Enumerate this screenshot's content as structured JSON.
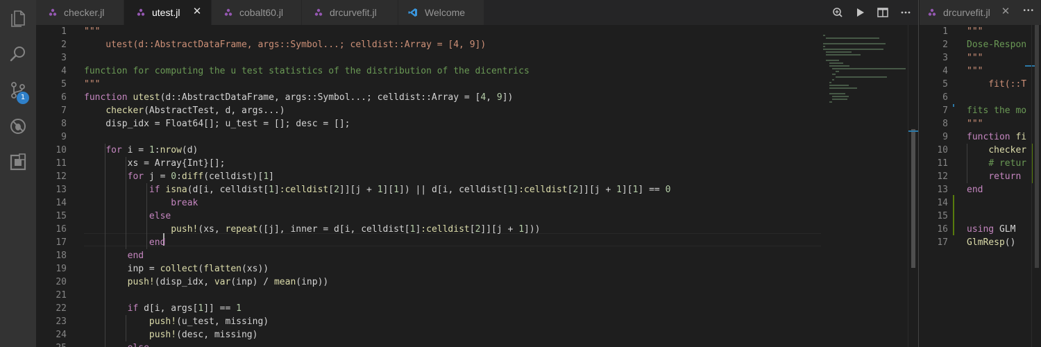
{
  "activity_bar": {
    "items": [
      "files-icon",
      "search-icon",
      "source-control-icon",
      "debug-icon",
      "extensions-icon"
    ],
    "source_control_badge": "1"
  },
  "tabs": [
    {
      "label": "checker.jl",
      "active": false,
      "icon": "julia-file-icon"
    },
    {
      "label": "utest.jl",
      "active": true,
      "icon": "julia-file-icon",
      "close": "✕"
    },
    {
      "label": "cobalt60.jl",
      "active": false,
      "icon": "julia-file-icon"
    },
    {
      "label": "drcurvefit.jl",
      "active": false,
      "icon": "julia-file-icon"
    },
    {
      "label": "Welcome",
      "active": false,
      "icon": "vscode-icon"
    }
  ],
  "tab_actions": [
    "open-changes-icon",
    "run-icon",
    "split-editor-icon",
    "more-actions-icon"
  ],
  "right_group": {
    "tab": {
      "label": "drcurvefit.jl",
      "close": "✕"
    },
    "more_actions": "•••"
  },
  "colors": {
    "accent": "#2f80c9",
    "string": "#ce9178",
    "keyword": "#c586c0",
    "function": "#dcdcaa",
    "number": "#b5cea8"
  },
  "main_editor": {
    "lines": [
      {
        "n": "1",
        "t": [
          [
            "t-str",
            "\"\"\""
          ]
        ]
      },
      {
        "n": "2",
        "t": [
          [
            "t-str",
            "    utest(d::AbstractDataFrame, args::Symbol...; celldist::Array = [4, 9])"
          ]
        ]
      },
      {
        "n": "3",
        "t": []
      },
      {
        "n": "4",
        "t": [
          [
            "t-doc",
            "function for computing the u test statistics of the distribution of the dicentrics"
          ]
        ]
      },
      {
        "n": "5",
        "t": [
          [
            "t-str",
            "\"\"\""
          ]
        ]
      },
      {
        "n": "6",
        "t": [
          [
            "t-kw",
            "function "
          ],
          [
            "t-fn",
            "utest"
          ],
          [
            "t-pl",
            "(d::AbstractDataFrame, args::Symbol...; celldist::Array = ["
          ],
          [
            "t-num",
            "4"
          ],
          [
            "t-pl",
            ", "
          ],
          [
            "t-num",
            "9"
          ],
          [
            "t-pl",
            "])"
          ]
        ]
      },
      {
        "n": "7",
        "t": [
          [
            "t-pl",
            "    "
          ],
          [
            "t-fn",
            "checker"
          ],
          [
            "t-pl",
            "(AbstractTest, d, args...)"
          ]
        ]
      },
      {
        "n": "8",
        "t": [
          [
            "t-pl",
            "    disp_idx = Float64[]; u_test = []; desc = [];"
          ]
        ]
      },
      {
        "n": "9",
        "t": []
      },
      {
        "n": "10",
        "t": [
          [
            "t-pl",
            "    "
          ],
          [
            "t-kw",
            "for"
          ],
          [
            "t-pl",
            " i = "
          ],
          [
            "t-num",
            "1"
          ],
          [
            "t-pl",
            ":"
          ],
          [
            "t-fn",
            "nrow"
          ],
          [
            "t-pl",
            "(d)"
          ]
        ]
      },
      {
        "n": "11",
        "t": [
          [
            "t-pl",
            "        xs = Array{Int}[];"
          ]
        ]
      },
      {
        "n": "12",
        "t": [
          [
            "t-pl",
            "        "
          ],
          [
            "t-kw",
            "for"
          ],
          [
            "t-pl",
            " j = "
          ],
          [
            "t-num",
            "0"
          ],
          [
            "t-pl",
            ":"
          ],
          [
            "t-fn",
            "diff"
          ],
          [
            "t-pl",
            "(celldist)["
          ],
          [
            "t-num",
            "1"
          ],
          [
            "t-pl",
            "]"
          ]
        ]
      },
      {
        "n": "13",
        "t": [
          [
            "t-pl",
            "            "
          ],
          [
            "t-kw",
            "if "
          ],
          [
            "t-fn",
            "isna"
          ],
          [
            "t-pl",
            "(d[i, celldist["
          ],
          [
            "t-num",
            "1"
          ],
          [
            "t-pl",
            "]"
          ],
          [
            "t-fn",
            ":celldist"
          ],
          [
            "t-pl",
            "["
          ],
          [
            "t-num",
            "2"
          ],
          [
            "t-pl",
            "]][j + "
          ],
          [
            "t-num",
            "1"
          ],
          [
            "t-pl",
            "]["
          ],
          [
            "t-num",
            "1"
          ],
          [
            "t-pl",
            "]) || d[i, celldist["
          ],
          [
            "t-num",
            "1"
          ],
          [
            "t-pl",
            "]"
          ],
          [
            "t-fn",
            ":celldist"
          ],
          [
            "t-pl",
            "["
          ],
          [
            "t-num",
            "2"
          ],
          [
            "t-pl",
            "]][j + "
          ],
          [
            "t-num",
            "1"
          ],
          [
            "t-pl",
            "]["
          ],
          [
            "t-num",
            "1"
          ],
          [
            "t-pl",
            "] == "
          ],
          [
            "t-num",
            "0"
          ]
        ]
      },
      {
        "n": "14",
        "t": [
          [
            "t-pl",
            "                "
          ],
          [
            "t-kw",
            "break"
          ]
        ]
      },
      {
        "n": "15",
        "t": [
          [
            "t-pl",
            "            "
          ],
          [
            "t-kw",
            "else"
          ]
        ]
      },
      {
        "n": "16",
        "t": [
          [
            "t-pl",
            "                "
          ],
          [
            "t-fn",
            "push!"
          ],
          [
            "t-pl",
            "(xs, "
          ],
          [
            "t-fn",
            "repeat"
          ],
          [
            "t-pl",
            "([j], inner = d[i, celldist["
          ],
          [
            "t-num",
            "1"
          ],
          [
            "t-pl",
            "]"
          ],
          [
            "t-fn",
            ":celldist"
          ],
          [
            "t-pl",
            "["
          ],
          [
            "t-num",
            "2"
          ],
          [
            "t-pl",
            "]][j + "
          ],
          [
            "t-num",
            "1"
          ],
          [
            "t-pl",
            "]))"
          ]
        ]
      },
      {
        "n": "17",
        "t": [
          [
            "t-pl",
            "            "
          ],
          [
            "t-kw",
            "end"
          ]
        ]
      },
      {
        "n": "18",
        "t": [
          [
            "t-pl",
            "        "
          ],
          [
            "t-kw",
            "end"
          ]
        ]
      },
      {
        "n": "19",
        "t": [
          [
            "t-pl",
            "        inp = "
          ],
          [
            "t-fn",
            "collect"
          ],
          [
            "t-pl",
            "("
          ],
          [
            "t-fn",
            "flatten"
          ],
          [
            "t-pl",
            "(xs))"
          ]
        ]
      },
      {
        "n": "20",
        "t": [
          [
            "t-pl",
            "        "
          ],
          [
            "t-fn",
            "push!"
          ],
          [
            "t-pl",
            "(disp_idx, "
          ],
          [
            "t-fn",
            "var"
          ],
          [
            "t-pl",
            "(inp) / "
          ],
          [
            "t-fn",
            "mean"
          ],
          [
            "t-pl",
            "(inp))"
          ]
        ]
      },
      {
        "n": "21",
        "t": []
      },
      {
        "n": "22",
        "t": [
          [
            "t-pl",
            "        "
          ],
          [
            "t-kw",
            "if"
          ],
          [
            "t-pl",
            " d[i, args["
          ],
          [
            "t-num",
            "1"
          ],
          [
            "t-pl",
            "]] == "
          ],
          [
            "t-num",
            "1"
          ]
        ]
      },
      {
        "n": "23",
        "t": [
          [
            "t-pl",
            "            "
          ],
          [
            "t-fn",
            "push!"
          ],
          [
            "t-pl",
            "(u_test, missing)"
          ]
        ]
      },
      {
        "n": "24",
        "t": [
          [
            "t-pl",
            "            "
          ],
          [
            "t-fn",
            "push!"
          ],
          [
            "t-pl",
            "(desc, missing)"
          ]
        ]
      },
      {
        "n": "25",
        "t": [
          [
            "t-pl",
            "        "
          ],
          [
            "t-kw",
            "else"
          ]
        ]
      }
    ]
  },
  "side_editor": {
    "lines": [
      {
        "n": "1",
        "t": [
          [
            "t-str",
            "\"\"\""
          ]
        ]
      },
      {
        "n": "2",
        "t": [
          [
            "t-doc",
            "Dose-Respon"
          ]
        ]
      },
      {
        "n": "3",
        "t": [
          [
            "t-str",
            "\"\"\""
          ]
        ]
      },
      {
        "n": "4",
        "t": [
          [
            "t-str",
            "\"\"\""
          ]
        ]
      },
      {
        "n": "5",
        "t": [
          [
            "t-str",
            "    fit(::T"
          ]
        ]
      },
      {
        "n": "6",
        "t": []
      },
      {
        "n": "7",
        "t": [
          [
            "t-doc",
            "fits the mo"
          ]
        ]
      },
      {
        "n": "8",
        "t": [
          [
            "t-str",
            "\"\"\""
          ]
        ]
      },
      {
        "n": "9",
        "t": [
          [
            "t-kw",
            "function "
          ],
          [
            "t-fn",
            "fi"
          ]
        ]
      },
      {
        "n": "10",
        "t": [
          [
            "t-pl",
            "    "
          ],
          [
            "t-fn",
            "checker"
          ]
        ]
      },
      {
        "n": "11",
        "t": [
          [
            "t-pl",
            "    "
          ],
          [
            "t-cm",
            "# retur"
          ]
        ]
      },
      {
        "n": "12",
        "t": [
          [
            "t-pl",
            "    "
          ],
          [
            "t-kw",
            "return"
          ]
        ]
      },
      {
        "n": "13",
        "t": [
          [
            "t-kw",
            "end"
          ]
        ]
      },
      {
        "n": "14",
        "t": []
      },
      {
        "n": "15",
        "t": []
      },
      {
        "n": "16",
        "t": [
          [
            "t-kw",
            "using "
          ],
          [
            "t-pl",
            "GLM"
          ]
        ]
      },
      {
        "n": "17",
        "t": [
          [
            "t-fn",
            "GlmResp"
          ],
          [
            "t-pl",
            "()"
          ]
        ]
      }
    ]
  }
}
